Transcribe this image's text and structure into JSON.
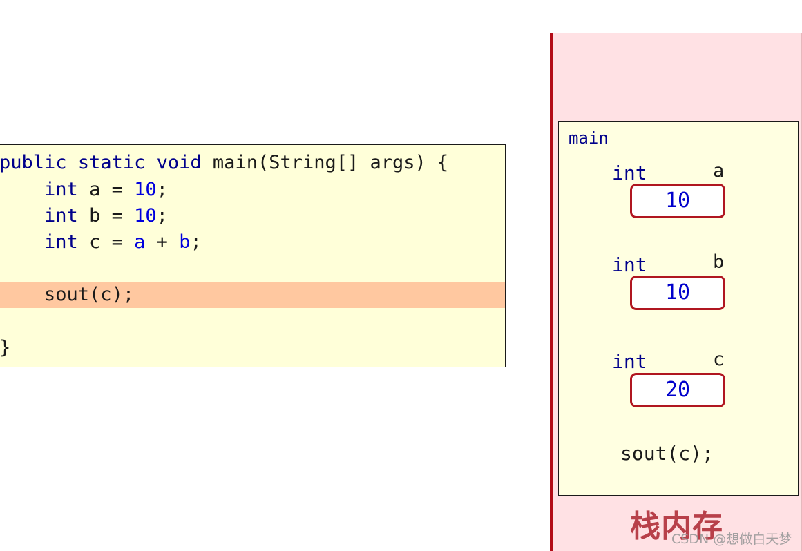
{
  "code": {
    "line1": {
      "kw1": "public",
      "kw2": "static",
      "kw3": "void",
      "rest": "main(String[] args) {"
    },
    "line2": {
      "type": "int",
      "name": "a =",
      "value": "10",
      "end": ";"
    },
    "line3": {
      "type": "int",
      "name": "b =",
      "value": "10",
      "end": ";"
    },
    "line4": {
      "type": "int",
      "name": "c =",
      "op_a": "a",
      "plus": "+",
      "op_b": "b",
      "end": ";"
    },
    "line5": "sout(c);",
    "line6": "}"
  },
  "stack": {
    "frame_title": "main",
    "vars": [
      {
        "type": "int",
        "name": "a",
        "value": "10"
      },
      {
        "type": "int",
        "name": "b",
        "value": "10"
      },
      {
        "type": "int",
        "name": "c",
        "value": "20"
      }
    ],
    "statement": "sout(c);",
    "label": "栈内存"
  },
  "watermark": "CSDN @想做白天梦",
  "colors": {
    "highlight": "#ffc8a0",
    "code_bg": "#ffffd9",
    "stack_bg": "#ffe1e4",
    "accent_red": "#b30c17",
    "keyword_blue": "#00008b",
    "literal_blue": "#0000dd"
  }
}
